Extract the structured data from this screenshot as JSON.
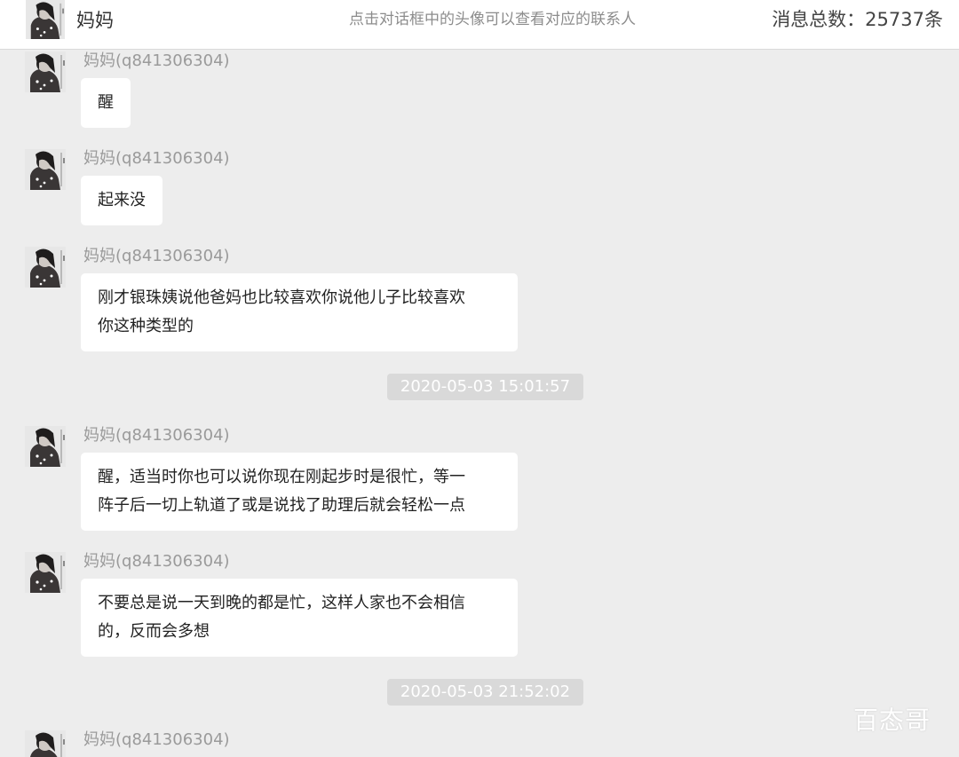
{
  "header": {
    "contact_name": "妈妈",
    "hint": "点击对话框中的头像可以查看对应的联系人",
    "message_count": "消息总数：25737条"
  },
  "messages": [
    {
      "sender": "妈妈(q841306304)",
      "text": "醒"
    },
    {
      "sender": "妈妈(q841306304)",
      "text": "起来没"
    },
    {
      "sender": "妈妈(q841306304)",
      "lines": [
        "刚才银珠姨说他爸妈也比较喜欢你说他儿子比较喜欢",
        "你这种类型的"
      ]
    },
    {
      "sender": "妈妈(q841306304)",
      "lines": [
        "醒，适当时你也可以说你现在刚起步时是很忙，等一",
        "阵子后一切上轨道了或是说找了助理后就会轻松一点"
      ]
    },
    {
      "sender": "妈妈(q841306304)",
      "lines": [
        "不要总是说一天到晚的都是忙，这样人家也不会相信",
        "的，反而会多想"
      ]
    },
    {
      "sender": "妈妈(q841306304)"
    }
  ],
  "timestamps": [
    "2020-05-03 15:01:57",
    "2020-05-03 21:52:02"
  ],
  "watermark": "百态哥",
  "icons": {
    "avatar": "contact-avatar-photo"
  },
  "colors": {
    "background": "#ededed",
    "bubble": "#ffffff",
    "timestamp_bg": "#d9d9d9",
    "sender": "#9a9a9a"
  }
}
